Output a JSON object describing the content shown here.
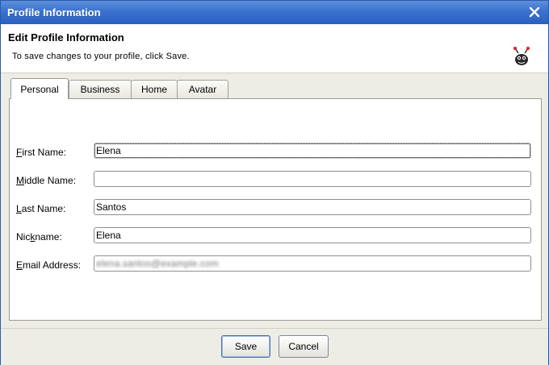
{
  "window": {
    "title": "Profile Information",
    "close_icon": "close-icon"
  },
  "header": {
    "title": "Edit Profile Information",
    "subtitle": "To save changes to your profile, click Save.",
    "logo_icon": "bug-mascot-icon"
  },
  "tabs": [
    {
      "label": "Personal",
      "active": true
    },
    {
      "label": "Business",
      "active": false
    },
    {
      "label": "Home",
      "active": false
    },
    {
      "label": "Avatar",
      "active": false
    }
  ],
  "form": {
    "fields": [
      {
        "label_first": "F",
        "label_rest": "irst Name:",
        "value": "Elena",
        "placeholder": ""
      },
      {
        "label_first": "M",
        "label_rest": "iddle Name:",
        "value": "",
        "placeholder": ""
      },
      {
        "label_first": "L",
        "label_rest": "ast Name:",
        "value": "Santos",
        "placeholder": ""
      },
      {
        "label_first": "Nic",
        "label_underline": "k",
        "label_rest": "name:",
        "value": "Elena",
        "placeholder": ""
      },
      {
        "label_first": "E",
        "label_rest": "mail Address:",
        "value": "elena.santos@example.com",
        "blurred": true,
        "placeholder": ""
      }
    ]
  },
  "footer": {
    "save_label": "Save",
    "cancel_label": "Cancel"
  },
  "colors": {
    "titlebar": "#3b72cf",
    "window_bg": "#eeede5",
    "panel_border": "#9a9a94"
  }
}
